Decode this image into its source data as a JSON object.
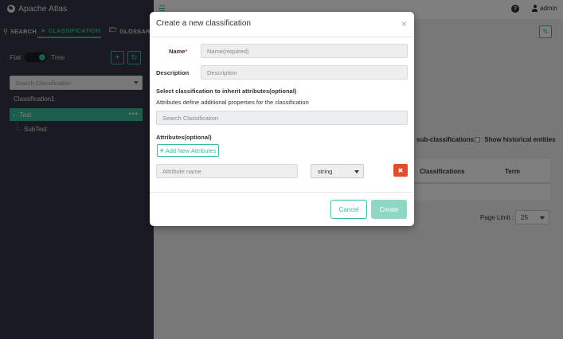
{
  "app": {
    "title": "Apache Atlas"
  },
  "sidebar": {
    "tabs": [
      {
        "label": "SEARCH",
        "icon": "search-icon"
      },
      {
        "label": "CLASSIFICATION",
        "icon": "tag-icon"
      },
      {
        "label": "GLOSSARY",
        "icon": "folder-open-icon"
      }
    ],
    "toggle": {
      "left": "Flat",
      "right": "Tree"
    },
    "search_placeholder": "Search Classification",
    "items": [
      {
        "label": "Classification1"
      },
      {
        "label": "Test"
      },
      {
        "label": "SubTest"
      }
    ]
  },
  "header": {
    "user": "admin",
    "menu_icon": "hamburger-icon",
    "help_icon": "question-icon"
  },
  "main": {
    "include_sub": "sub-classifications",
    "show_historical": "Show historical entities",
    "columns": [
      "Classifications",
      "Term"
    ],
    "page_limit_label": "Page Limit :",
    "page_limit_value": "25"
  },
  "modal": {
    "title": "Create a new classification",
    "close": "×",
    "name_label": "Name",
    "name_required_marker": "*",
    "name_placeholder": "Name(required)",
    "description_label": "Description",
    "description_placeholder": "Description",
    "inherit_label": "Select classification to inherit attributes(optional)",
    "inherit_help": "Attributes define additional properties for the classification",
    "inherit_placeholder": "Search Classification",
    "attributes_label": "Attributes(optional)",
    "add_attributes": "Add New Attributes",
    "attribute_name_placeholder": "Attribute name",
    "attribute_type": "string",
    "cancel": "Cancel",
    "create": "Create"
  },
  "colors": {
    "accent": "#38bb9b",
    "sidebar_bg": "#323544",
    "danger": "#e14e2c",
    "create_disabled": "#8dd8c5"
  }
}
